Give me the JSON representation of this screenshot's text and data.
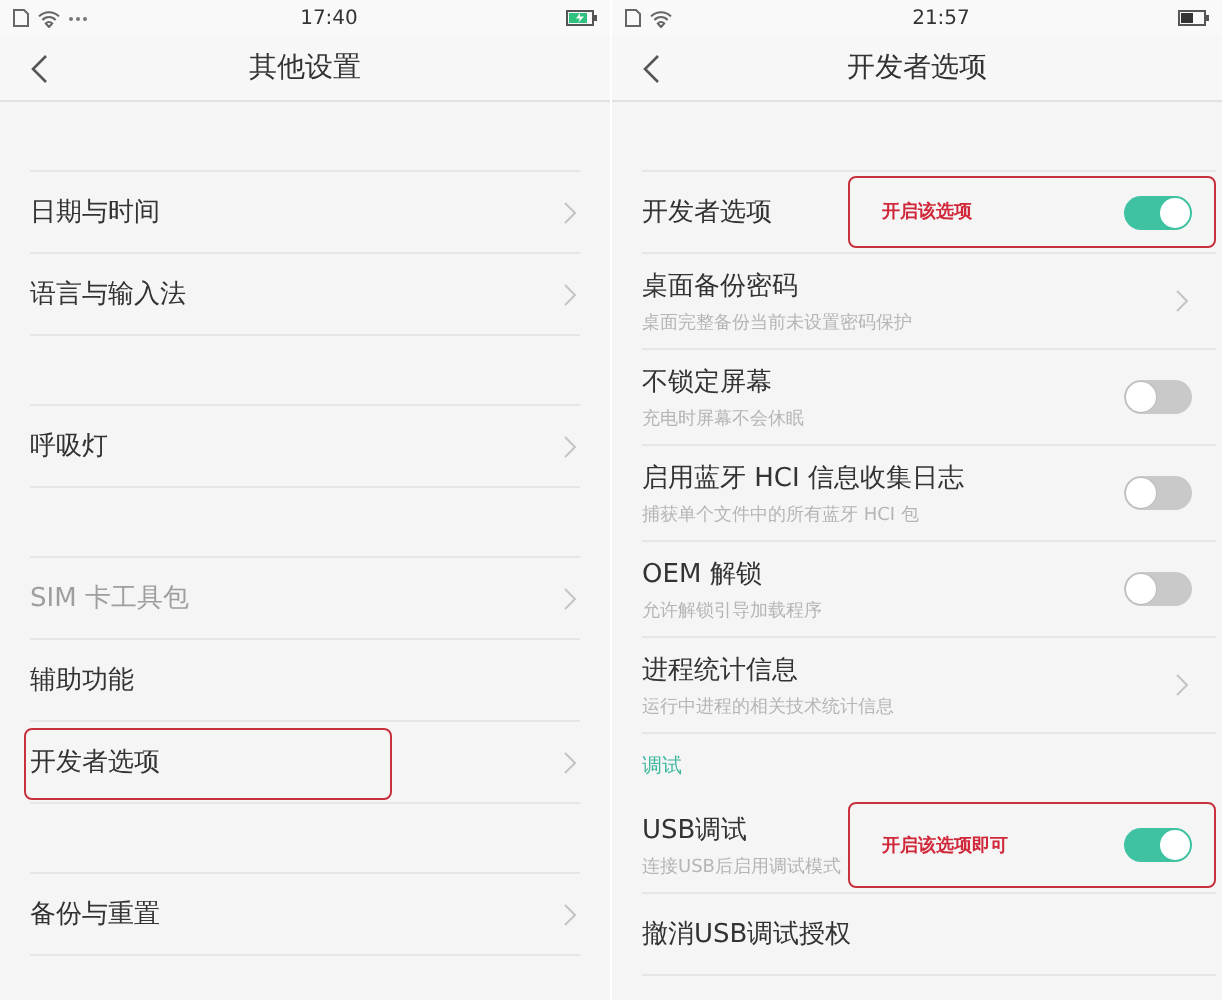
{
  "screens": [
    {
      "status": {
        "time": "17:40",
        "charging": true,
        "more": true
      },
      "title": "其他设置",
      "groups": [
        {
          "items": [
            {
              "label": "日期与时间",
              "kind": "link",
              "disabled": false,
              "annotated": false
            },
            {
              "label": "语言与输入法",
              "kind": "link",
              "disabled": false,
              "annotated": false
            }
          ]
        },
        {
          "items": [
            {
              "label": "呼吸灯",
              "kind": "link",
              "disabled": false,
              "annotated": false
            }
          ]
        },
        {
          "items": [
            {
              "label": "SIM 卡工具包",
              "kind": "link",
              "disabled": true,
              "annotated": false
            },
            {
              "label": "辅助功能",
              "kind": "plain",
              "disabled": false,
              "annotated": false
            },
            {
              "label": "开发者选项",
              "kind": "link",
              "disabled": false,
              "annotated": true
            }
          ]
        },
        {
          "items": [
            {
              "label": "备份与重置",
              "kind": "link",
              "disabled": false,
              "annotated": false
            }
          ]
        }
      ]
    },
    {
      "status": {
        "time": "21:57",
        "charging": false,
        "more": false
      },
      "title": "开发者选项",
      "groups": [
        {
          "items": [
            {
              "label": "开发者选项",
              "kind": "toggle",
              "on": true,
              "disabled": false,
              "annotated": true,
              "note": "开启该选项"
            },
            {
              "label": "桌面备份密码",
              "subtitle": "桌面完整备份当前未设置密码保护",
              "kind": "link",
              "disabled": false,
              "annotated": false
            },
            {
              "label": "不锁定屏幕",
              "subtitle": "充电时屏幕不会休眠",
              "kind": "toggle",
              "on": false,
              "disabled": false,
              "annotated": false
            },
            {
              "label": "启用蓝牙 HCI 信息收集日志",
              "subtitle": "捕获单个文件中的所有蓝牙 HCI 包",
              "kind": "toggle",
              "on": false,
              "disabled": false,
              "annotated": false
            },
            {
              "label": "OEM 解锁",
              "subtitle": "允许解锁引导加载程序",
              "kind": "toggle",
              "on": false,
              "disabled": false,
              "annotated": false
            },
            {
              "label": "进程统计信息",
              "subtitle": "运行中进程的相关技术统计信息",
              "kind": "link",
              "disabled": false,
              "annotated": false
            }
          ]
        },
        {
          "header": "调试",
          "items": [
            {
              "label": "USB调试",
              "subtitle": "连接USB后启用调试模式",
              "kind": "toggle",
              "on": true,
              "disabled": false,
              "annotated": true,
              "note": "开启该选项即可"
            },
            {
              "label": "撤消USB调试授权",
              "kind": "plain",
              "disabled": false,
              "annotated": false
            }
          ]
        }
      ]
    }
  ]
}
